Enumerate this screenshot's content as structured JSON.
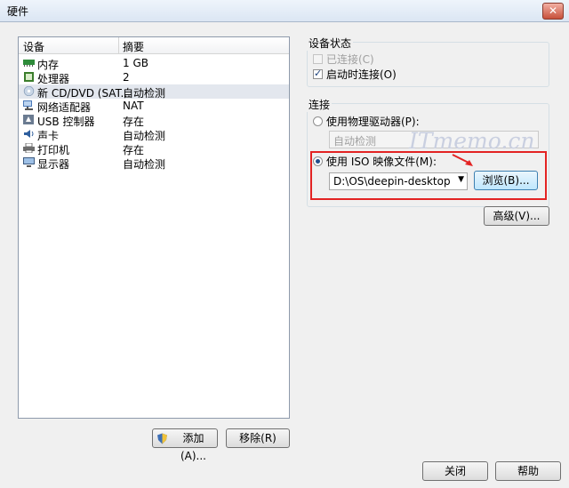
{
  "window": {
    "title": "硬件",
    "close_glyph": "✕"
  },
  "device_list": {
    "header": {
      "device": "设备",
      "summary": "摘要"
    },
    "items": [
      {
        "name": "内存",
        "value": "1 GB",
        "icon": "memory-icon"
      },
      {
        "name": "处理器",
        "value": "2",
        "icon": "processor-icon"
      },
      {
        "name": "新 CD/DVD (SAT...",
        "value": "自动检测",
        "icon": "cd-dvd-icon",
        "selected": true
      },
      {
        "name": "网络适配器",
        "value": "NAT",
        "icon": "network-adapter-icon"
      },
      {
        "name": "USB 控制器",
        "value": "存在",
        "icon": "usb-icon"
      },
      {
        "name": "声卡",
        "value": "自动检测",
        "icon": "sound-card-icon"
      },
      {
        "name": "打印机",
        "value": "存在",
        "icon": "printer-icon"
      },
      {
        "name": "显示器",
        "value": "自动检测",
        "icon": "display-icon"
      }
    ]
  },
  "buttons": {
    "add": "添加(A)...",
    "remove": "移除(R)",
    "close": "关闭",
    "help": "帮助",
    "advanced": "高级(V)...",
    "browse": "浏览(B)..."
  },
  "device_status": {
    "label": "设备状态",
    "connected": "已连接(C)",
    "connect_on_power": "启动时连接(O)"
  },
  "connection": {
    "label": "连接",
    "use_physical": "使用物理驱动器(P):",
    "physical_value": "自动检测",
    "use_iso": "使用 ISO 映像文件(M):",
    "iso_path": "D:\\OS\\deepin-desktop-comr"
  },
  "watermark": "ITmemo.cn",
  "colors": {
    "highlight": "#e32323",
    "selection": "#e3e7ee"
  }
}
